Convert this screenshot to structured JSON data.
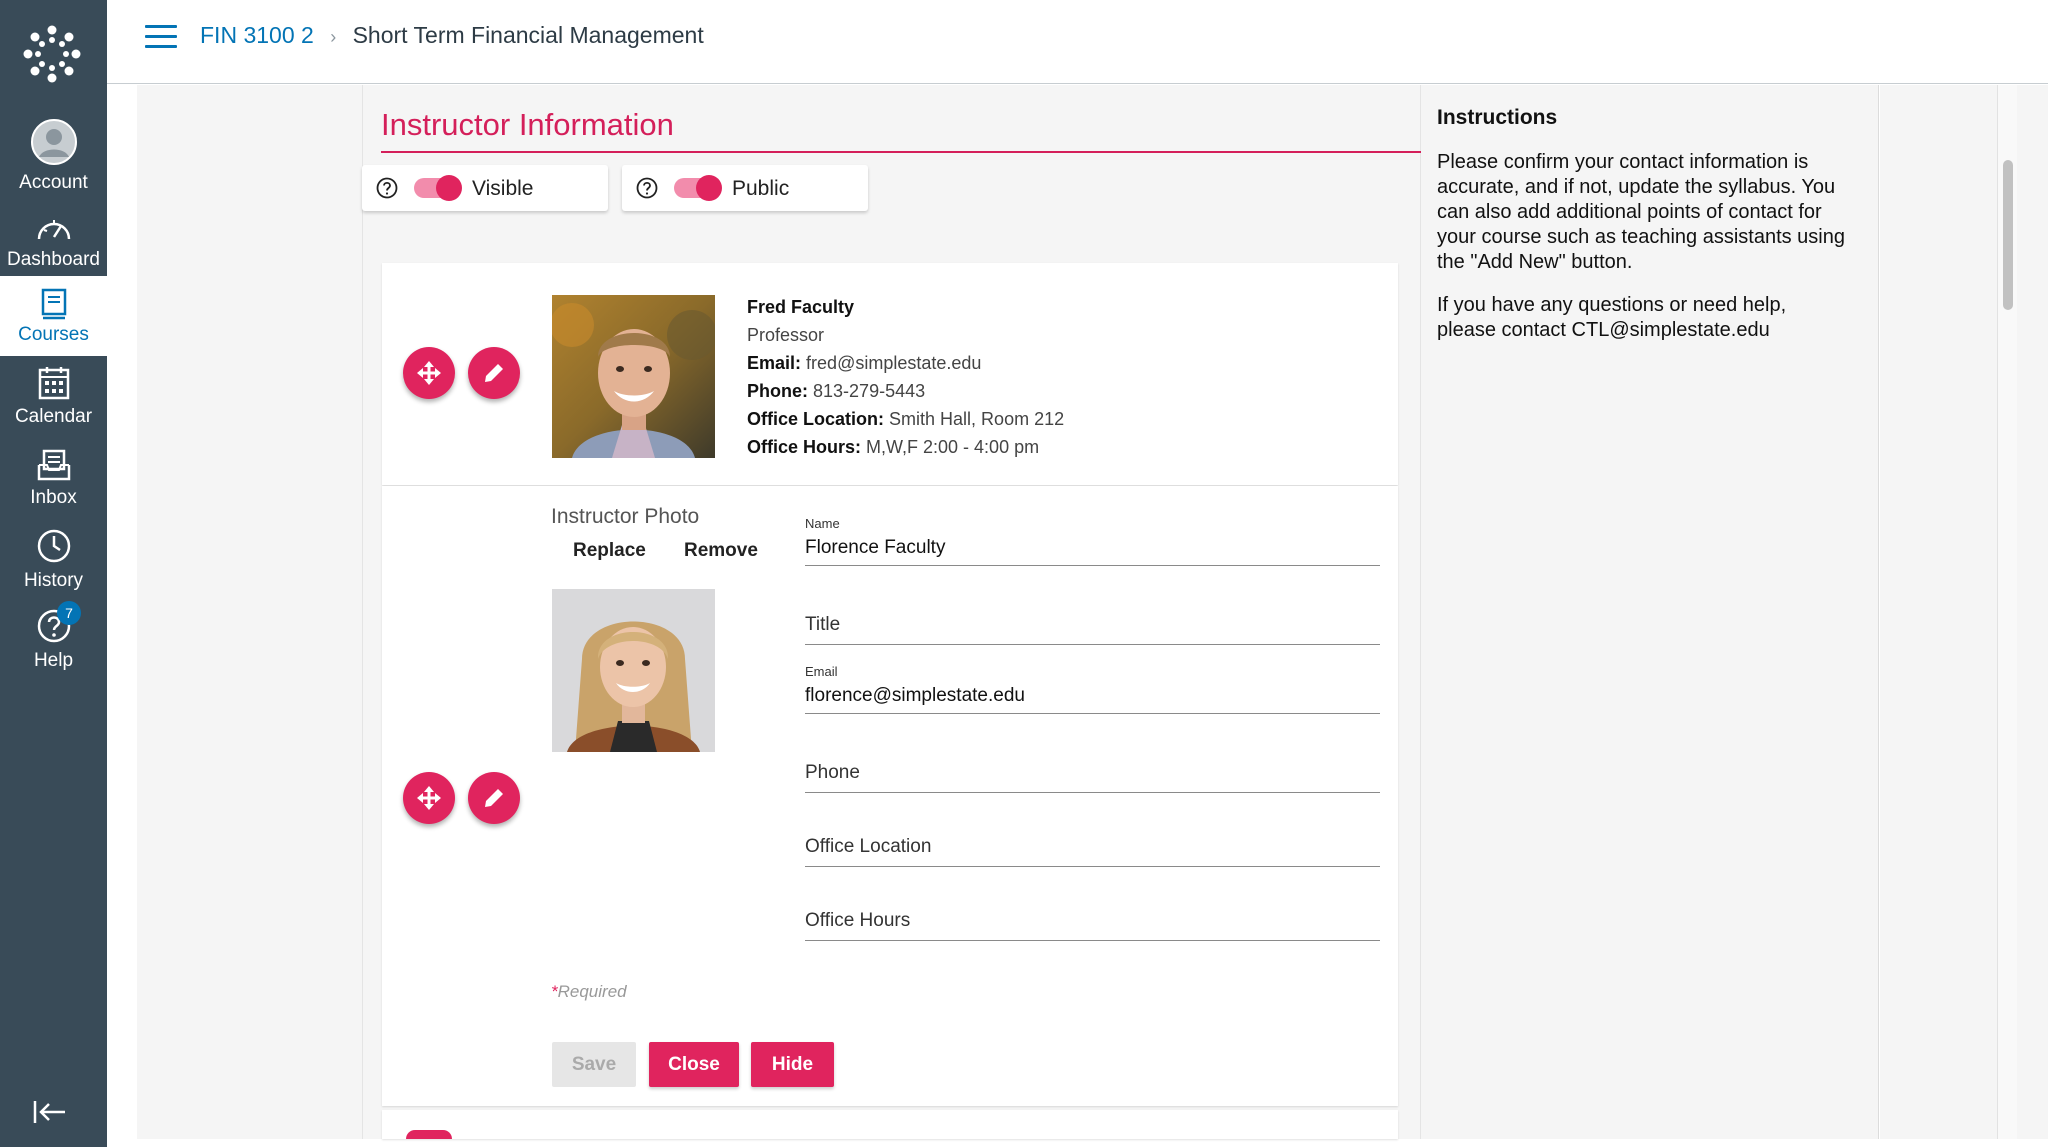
{
  "nav": {
    "items": [
      {
        "label": "Account",
        "icon": "account-icon"
      },
      {
        "label": "Dashboard",
        "icon": "dashboard-icon"
      },
      {
        "label": "Courses",
        "icon": "courses-icon"
      },
      {
        "label": "Calendar",
        "icon": "calendar-icon"
      },
      {
        "label": "Inbox",
        "icon": "inbox-icon"
      },
      {
        "label": "History",
        "icon": "history-icon"
      },
      {
        "label": "Help",
        "icon": "help-icon"
      }
    ],
    "help_badge": "7",
    "active": "Courses"
  },
  "breadcrumb": {
    "course": "FIN 3100 2",
    "separator": "›",
    "page": "Short Term Financial Management"
  },
  "section": {
    "title": "Instructor Information",
    "toggles": [
      {
        "label": "Visible",
        "on": true
      },
      {
        "label": "Public",
        "on": true
      }
    ]
  },
  "instructor_card": {
    "name": "Fred Faculty",
    "title": "Professor",
    "email_label": "Email:",
    "email": "fred@simplestate.edu",
    "phone_label": "Phone:",
    "phone": "813-279-5443",
    "office_label": "Office Location:",
    "office": "Smith Hall, Room 212",
    "hours_label": "Office Hours:",
    "hours": "M,W,F 2:00 - 4:00 pm"
  },
  "edit_card": {
    "photo_label": "Instructor Photo",
    "replace": "Replace",
    "remove": "Remove",
    "fields": {
      "name_label": "Name",
      "name_value": "Florence Faculty",
      "title_placeholder": "Title",
      "email_label": "Email",
      "email_value": "florence@simplestate.edu",
      "phone_placeholder": "Phone",
      "office_placeholder": "Office Location",
      "hours_placeholder": "Office Hours"
    },
    "required_star": "*",
    "required_text": "Required",
    "buttons": {
      "save": "Save",
      "close": "Close",
      "hide": "Hide"
    }
  },
  "instructions": {
    "title": "Instructions",
    "p1": "Please confirm your contact information is accurate, and if not, update the syllabus. You can also add additional points of contact for your course such as teaching assistants using the \"Add New\" button.",
    "p2": "If you have any questions or need help, please contact CTL@simplestate.edu"
  },
  "colors": {
    "accent": "#e0245e",
    "nav_bg": "#394b58",
    "link": "#0374b5"
  }
}
